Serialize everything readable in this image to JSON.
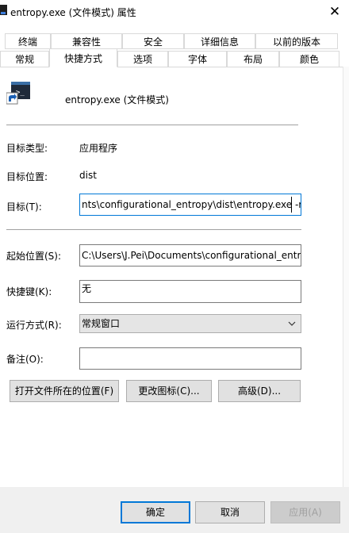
{
  "window": {
    "title": "entropy.exe (文件模式) 属性",
    "close_glyph": "✕"
  },
  "tabs_row1": [
    {
      "label": "终端"
    },
    {
      "label": "兼容性"
    },
    {
      "label": "安全"
    },
    {
      "label": "详细信息"
    },
    {
      "label": "以前的版本"
    }
  ],
  "tabs_row2": [
    {
      "label": "常规"
    },
    {
      "label": "快捷方式",
      "active": true
    },
    {
      "label": "选项"
    },
    {
      "label": "字体"
    },
    {
      "label": "布局"
    },
    {
      "label": "颜色"
    }
  ],
  "shortcut": {
    "name": "entropy.exe (文件模式)",
    "icon": "program-shortcut-icon",
    "target_type_label": "目标类型:",
    "target_type_value": "应用程序",
    "target_location_label": "目标位置:",
    "target_location_value": "dist",
    "target_label": "目标(T):",
    "target_value": "nts\\configurational_entropy\\dist\\entropy.exe -r",
    "start_in_label": "起始位置(S):",
    "start_in_value": "C:\\Users\\J.Pei\\Documents\\configurational_entrc",
    "hotkey_label": "快捷键(K):",
    "hotkey_value": "无",
    "run_label": "运行方式(R):",
    "run_value": "常规窗口",
    "comment_label": "备注(O):",
    "comment_value": "",
    "open_location_label": "打开文件所在的位置(F)",
    "change_icon_label": "更改图标(C)...",
    "advanced_label": "高级(D)..."
  },
  "footer": {
    "ok_label": "确定",
    "cancel_label": "取消",
    "apply_label": "应用(A)"
  },
  "colors": {
    "focus": "#0078d7",
    "button_face": "#e1e1e1",
    "footer_bg": "#f0f0f0"
  }
}
